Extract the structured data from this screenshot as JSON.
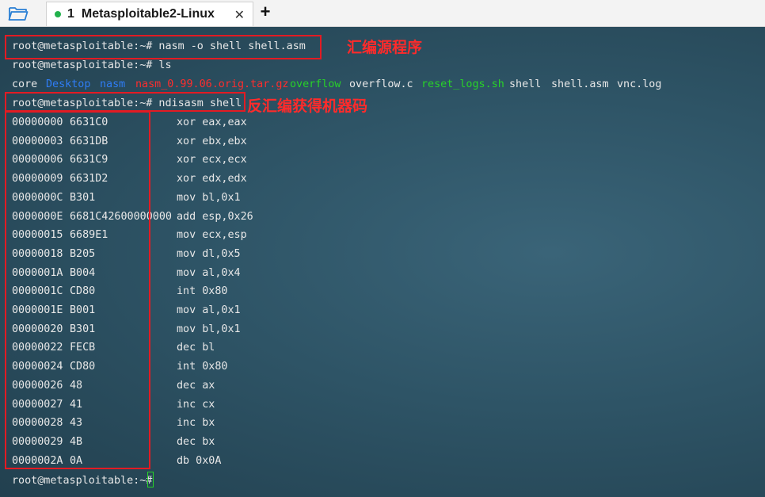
{
  "tabbar": {
    "tabs": [
      {
        "number": "1",
        "title": "Metasploitable2-Linux",
        "status_color": "#22b14c",
        "close_label": "✕"
      }
    ],
    "new_tab_label": "+"
  },
  "terminal": {
    "prompt": "root@metasploitable:~#",
    "commands": {
      "nasm": "root@metasploitable:~# nasm -o shell shell.asm",
      "ls": "root@metasploitable:~# ls",
      "ndisasm": "root@metasploitable:~# ndisasm shell"
    },
    "ls_output": [
      {
        "name": "core",
        "color": "#e8e8e8"
      },
      {
        "name": "Desktop",
        "color": "#2f7df6"
      },
      {
        "name": "nasm",
        "color": "#2f7df6"
      },
      {
        "name": "nasm_0.99.06.orig.tar.gz",
        "color": "#ff2d2d"
      },
      {
        "name": "overflow",
        "color": "#28d228"
      },
      {
        "name": "overflow.c",
        "color": "#e8e8e8"
      },
      {
        "name": "reset_logs.sh",
        "color": "#28d228"
      },
      {
        "name": "shell",
        "color": "#e8e8e8"
      },
      {
        "name": "shell.asm",
        "color": "#e8e8e8"
      },
      {
        "name": "vnc.log",
        "color": "#e8e8e8"
      }
    ],
    "disassembly": [
      {
        "addr": "00000000",
        "hex": "6631C0",
        "ins": "xor eax,eax"
      },
      {
        "addr": "00000003",
        "hex": "6631DB",
        "ins": "xor ebx,ebx"
      },
      {
        "addr": "00000006",
        "hex": "6631C9",
        "ins": "xor ecx,ecx"
      },
      {
        "addr": "00000009",
        "hex": "6631D2",
        "ins": "xor edx,edx"
      },
      {
        "addr": "0000000C",
        "hex": "B301",
        "ins": "mov bl,0x1"
      },
      {
        "addr": "0000000E",
        "hex": "6681C42600000000",
        "ins": "add esp,0x26"
      },
      {
        "addr": "00000015",
        "hex": "6689E1",
        "ins": "mov ecx,esp"
      },
      {
        "addr": "00000018",
        "hex": "B205",
        "ins": "mov dl,0x5"
      },
      {
        "addr": "0000001A",
        "hex": "B004",
        "ins": "mov al,0x4"
      },
      {
        "addr": "0000001C",
        "hex": "CD80",
        "ins": "int 0x80"
      },
      {
        "addr": "0000001E",
        "hex": "B001",
        "ins": "mov al,0x1"
      },
      {
        "addr": "00000020",
        "hex": "B301",
        "ins": "mov bl,0x1"
      },
      {
        "addr": "00000022",
        "hex": "FECB",
        "ins": "dec bl"
      },
      {
        "addr": "00000024",
        "hex": "CD80",
        "ins": "int 0x80"
      },
      {
        "addr": "00000026",
        "hex": "48",
        "ins": "dec ax"
      },
      {
        "addr": "00000027",
        "hex": "41",
        "ins": "inc cx"
      },
      {
        "addr": "00000028",
        "hex": "43",
        "ins": "inc bx"
      },
      {
        "addr": "00000029",
        "hex": "4B",
        "ins": "dec bx"
      },
      {
        "addr": "0000002A",
        "hex": "0A",
        "ins": "db 0x0A"
      }
    ],
    "annotations": {
      "compile": "汇编源程序",
      "disassemble": "反汇编获得机器码"
    },
    "annotation_color": "#ff2b2b"
  }
}
